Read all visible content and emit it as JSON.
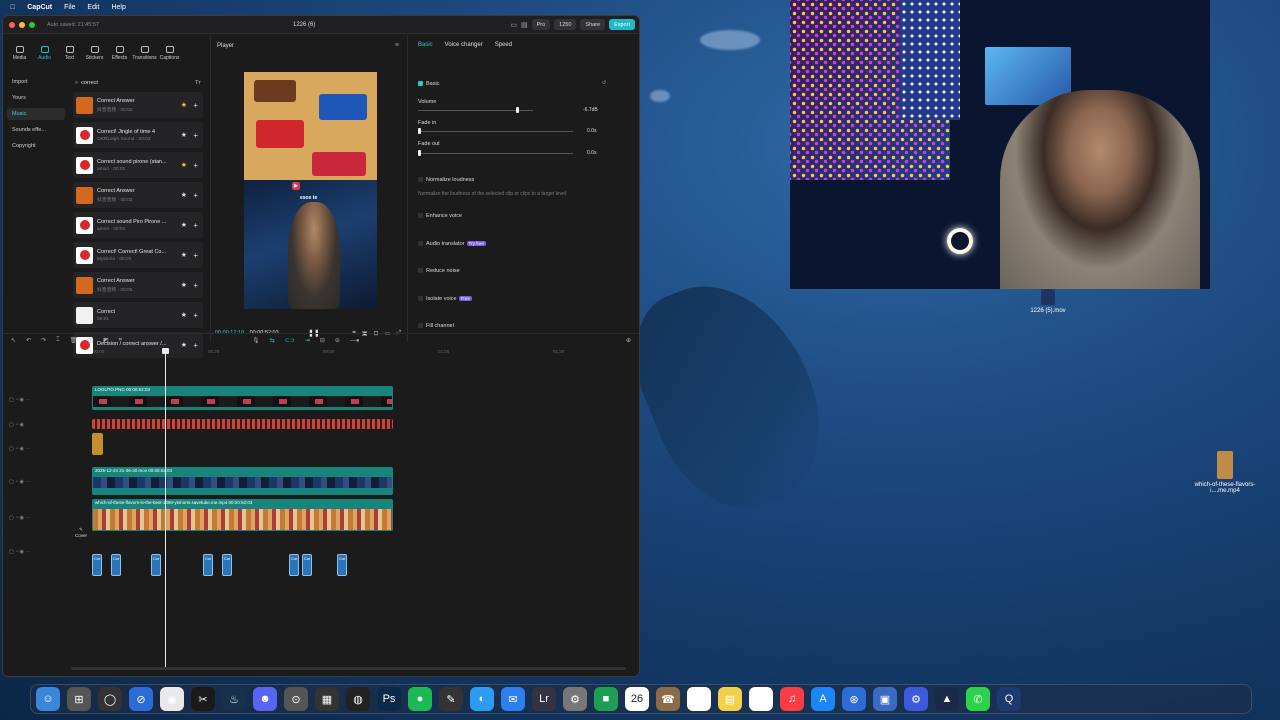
{
  "menubar": {
    "app": "CapCut",
    "items": [
      "File",
      "Edit",
      "Help"
    ]
  },
  "window": {
    "autosave": "Auto saved: 21:45:57",
    "title": "1226 (6)",
    "pro": "Pro",
    "credits": "1250",
    "share": "Share",
    "export": "Export"
  },
  "toolbar": [
    "Media",
    "Audio",
    "Text",
    "Stickers",
    "Effects",
    "Transitions",
    "Captions"
  ],
  "sidebar": [
    "Import",
    "Yours",
    "Music",
    "Sounds effe...",
    "Copyright"
  ],
  "search": {
    "value": "correct",
    "tt": "Tт"
  },
  "sounds": [
    {
      "title": "Correct Answer",
      "sub": "抖音音频 · 00:02",
      "fav": true,
      "thumb": "o"
    },
    {
      "title": "Correct! Jingle of time 4",
      "sub": "OKRLeigh Sound · 00:02",
      "fav": false,
      "thumb": "r"
    },
    {
      "title": "Correct sound pirone (stan...",
      "sub": "amori · 00:01",
      "fav": true,
      "thumb": "r"
    },
    {
      "title": "Correct Answer",
      "sub": "抖音音频 · 00:02",
      "fav": false,
      "thumb": "o"
    },
    {
      "title": "Correct sound Piro Pirone ...",
      "sub": "amori · 00:01",
      "fav": false,
      "thumb": "r"
    },
    {
      "title": "Correct! Correct! Great Co...",
      "sub": "Mysteria · 00:01",
      "fav": false,
      "thumb": "r"
    },
    {
      "title": "Correct Answer",
      "sub": "抖音音频 · 00:05",
      "fav": false,
      "thumb": "o"
    },
    {
      "title": "Correct",
      "sub": "00:01",
      "fav": false,
      "thumb": "w"
    },
    {
      "title": "Decision / correct answer /...",
      "sub": "",
      "fav": false,
      "thumb": "r"
    }
  ],
  "player": {
    "label": "Player",
    "current": "00:00:12:19",
    "total": "00:00:52:03",
    "sticker_text": "esos te"
  },
  "props": {
    "tabs": [
      "Basic",
      "Voice changer",
      "Speed"
    ],
    "basic": "Basic",
    "volume_label": "Volume",
    "volume_value": "-6.7dB",
    "fadein_label": "Fade in",
    "fadein_value": "0.0s",
    "fadeout_label": "Fade out",
    "fadeout_value": "0.0s",
    "normalize": "Normalize loudness",
    "normalize_hint": "Normalize the loudness of the selected clip or clips to a target level.",
    "enhance": "Enhance voice",
    "translator": "Audio translator",
    "translator_badge": "Try free",
    "reduce": "Reduce noise",
    "isolate": "Isolate voice",
    "isolate_badge": "Free",
    "fill": "Fill channel"
  },
  "timeline": {
    "ruler": [
      "00:00",
      "00:20",
      "00:40",
      "01:00",
      "01:20"
    ],
    "sticker_clip": "LOGUTO.PNG  00:00:52:03",
    "cam_clip": "2025-12-24 21-36-30.mov  00:00:52:03",
    "main_clip": "which-of-these-flavors-is-the-best-1080-ytshorts.savetube.me.mp4  00:00:52:03",
    "cover": "Cover",
    "small_clip_label": "Cor"
  },
  "desktop": {
    "file1": "1226 (5).mov",
    "file2": "which-of-these-flavors-i....me.mp4"
  },
  "dock": [
    "finder",
    "launchpad",
    "siri",
    "safari",
    "chrome",
    "capcut",
    "steam",
    "discord",
    "obs",
    "calculator",
    "obs-studio",
    "photoshop",
    "spotify",
    "script",
    "messages",
    "mail",
    "lightroom",
    "settings",
    "facetime",
    "calendar",
    "contacts",
    "reminders",
    "notes",
    "freeform",
    "music",
    "appstore",
    "safari-2",
    "preview",
    "instruments",
    "affinity",
    "phone",
    "quicktime"
  ],
  "dock_calendar": "26"
}
